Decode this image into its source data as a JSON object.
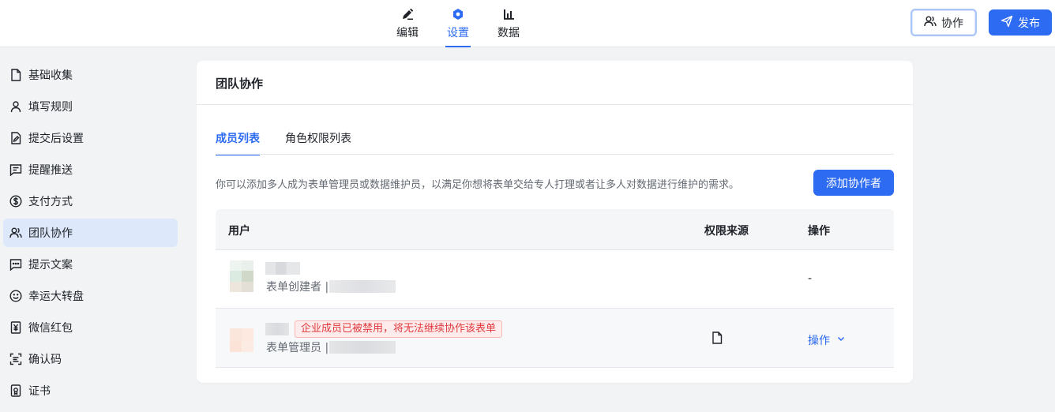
{
  "topbar": {
    "tabs": [
      {
        "label": "编辑",
        "icon": "pen-icon"
      },
      {
        "label": "设置",
        "icon": "settings-hexagon-icon",
        "active": true
      },
      {
        "label": "数据",
        "icon": "bar-chart-icon"
      }
    ],
    "collab_label": "协作",
    "publish_label": "发布"
  },
  "sidebar": {
    "items": [
      {
        "label": "基础收集",
        "icon": "file-icon"
      },
      {
        "label": "填写规则",
        "icon": "user-icon"
      },
      {
        "label": "提交后设置",
        "icon": "file-edit-icon"
      },
      {
        "label": "提醒推送",
        "icon": "message-icon"
      },
      {
        "label": "支付方式",
        "icon": "dollar-circle-icon"
      },
      {
        "label": "团队协作",
        "icon": "users-icon",
        "active": true
      },
      {
        "label": "提示文案",
        "icon": "chat-dots-icon"
      },
      {
        "label": "幸运大转盘",
        "icon": "smile-icon"
      },
      {
        "label": "微信红包",
        "icon": "yen-icon"
      },
      {
        "label": "确认码",
        "icon": "scan-icon"
      },
      {
        "label": "证书",
        "icon": "certificate-icon"
      }
    ]
  },
  "card": {
    "title": "团队协作",
    "tabs": [
      {
        "label": "成员列表",
        "active": true
      },
      {
        "label": "角色权限列表"
      }
    ],
    "description": "你可以添加多人成为表单管理员或数据维护员，以满足你想将表单交给专人打理或者让多人对数据进行维护的需求。",
    "add_button": "添加协作者",
    "table": {
      "headers": {
        "user": "用户",
        "source": "权限来源",
        "action": "操作"
      },
      "rows": [
        {
          "role": "表单创建者 |",
          "action": "-"
        },
        {
          "role": "表单管理员 |",
          "warning": "企业成员已被禁用，将无法继续协作该表单",
          "action": "操作"
        }
      ]
    }
  },
  "colors": {
    "accent": "#2c6bf2",
    "danger": "#e0383e",
    "active_bg": "#dde8fb"
  }
}
